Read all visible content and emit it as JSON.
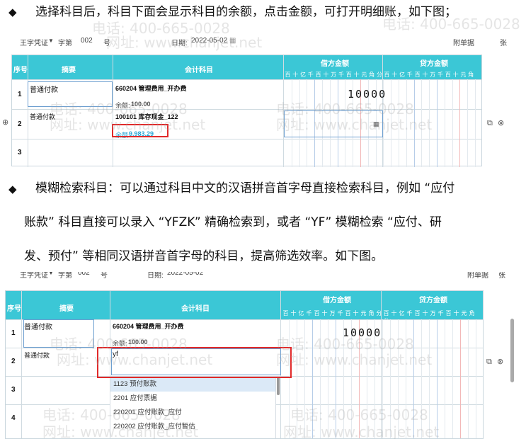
{
  "section1": {
    "bullet": "◆",
    "text": "选择科目后，科目下面会显示科目的余额，点击金额，可打开明细账，如下图；"
  },
  "section2": {
    "bullet": "◆",
    "lines": [
      "模糊检索科目：可以通过科目中文的汉语拼音首字母直接检索科目，例如 “应付",
      "账款” 科目直接可以录入 “YFZK” 精确检索到，或者 “YF” 模糊检索 “应付、研",
      "发、预付” 等相同汉语拼音首字母的科目，提高筛选效率。如下图。"
    ]
  },
  "voucher_header": {
    "voucher_type": "王字凭证",
    "zi_label": "字第",
    "number": "002",
    "hao_label": "号",
    "date_label": "日期:",
    "date": "2022-05-02",
    "attach_label": "附单据",
    "zhang_label": "张"
  },
  "voucher_header2": {
    "voucher_type": "王字凭证",
    "zi_label": "字第",
    "number": "002",
    "hao_label": "号",
    "date_label": "日期:",
    "date": "2022-05-02",
    "attach_label": "附单据",
    "zhang_label": "张"
  },
  "table_headers": {
    "seq": "序号",
    "summary": "摘要",
    "account": "会计科目",
    "debit": "借方金额",
    "credit": "贷方金额",
    "digits": [
      "百",
      "十",
      "亿",
      "千",
      "百",
      "十",
      "万",
      "千",
      "百",
      "十",
      "元",
      "角",
      "分"
    ]
  },
  "table1": {
    "rows": [
      {
        "seq": "1",
        "summary": "普通付款",
        "account": "660204 管理费用_开办费",
        "balance_label": "余额:",
        "balance": "100.00",
        "debit": "10000"
      },
      {
        "seq": "2",
        "summary": "普通付款",
        "account": "100101 库存现金_122",
        "balance_label": "余额:",
        "balance": "9,983.29",
        "debit": ""
      },
      {
        "seq": "3",
        "summary": "",
        "account": "",
        "balance_label": "",
        "balance": "",
        "debit": ""
      }
    ]
  },
  "table2": {
    "rows": [
      {
        "seq": "1",
        "summary": "普通付款",
        "account": "660204 管理费用_开办费",
        "balance_label": "余额:",
        "balance": "100.00",
        "debit": "10000"
      },
      {
        "seq": "2",
        "summary": "普通付款",
        "account_input": "yf",
        "debit": ""
      },
      {
        "seq": "3"
      },
      {
        "seq": "4"
      }
    ],
    "dropdown": [
      "1123 预付账款",
      "2201 应付票据",
      "220201 应付账款_应付",
      "220202 应付账款_应付暂估"
    ]
  },
  "watermark": {
    "phone": "电话: 400-665-0028",
    "site": "网址: www.chanjet.net"
  },
  "colors": {
    "header_bg": "#3bc7d6",
    "highlight_red": "#e12a2a",
    "balance_blue": "#2aa6d6"
  }
}
